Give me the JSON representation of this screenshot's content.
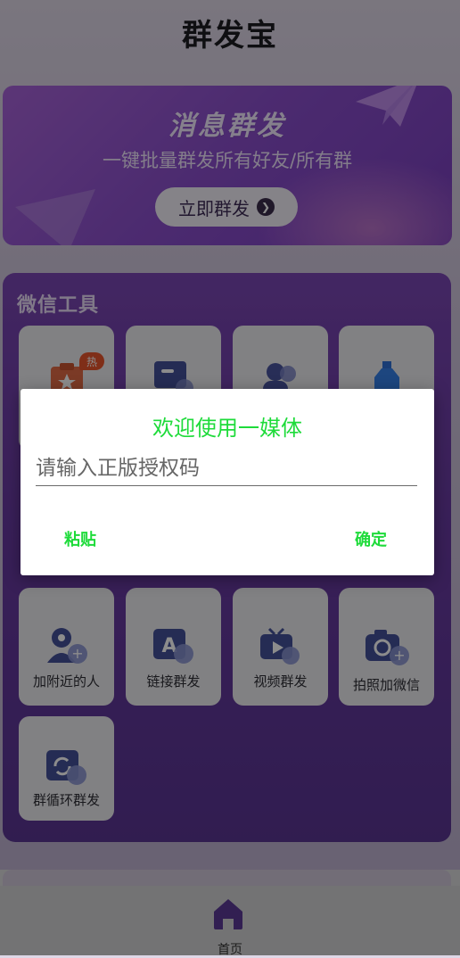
{
  "app": {
    "title": "群发宝"
  },
  "banner": {
    "title": "消息群发",
    "subtitle": "一键批量群发所有好友/所有群",
    "button_label": "立即群发",
    "arrow_icon": "chevron-right-circle-icon"
  },
  "tools": {
    "title": "微信工具",
    "hot_badge": "热",
    "items": [
      {
        "label": "",
        "icon": "clipboard-star-icon"
      },
      {
        "label": "",
        "icon": "message-card-icon"
      },
      {
        "label": "",
        "icon": "people-icon"
      },
      {
        "label": "",
        "icon": "bottle-icon"
      },
      {
        "label": "加附近的人",
        "icon": "location-add-user-icon"
      },
      {
        "label": "链接群发",
        "icon": "link-a-icon"
      },
      {
        "label": "视频群发",
        "icon": "tv-play-icon"
      },
      {
        "label": "拍照加微信",
        "icon": "camera-add-icon"
      },
      {
        "label": "群循环群发",
        "icon": "loop-icon"
      }
    ]
  },
  "dialog": {
    "title": "欢迎使用一媒体",
    "input_placeholder": "请输入正版授权码",
    "input_value": "",
    "paste_label": "粘贴",
    "confirm_label": "确定"
  },
  "nav": {
    "home_label": "首页",
    "home_icon": "home-icon"
  },
  "colors": {
    "accent_green": "#1edb3a",
    "panel_purple": "#6a3ba3",
    "banner_purple": "#8b4fcc",
    "hot_orange": "#e8542c"
  }
}
